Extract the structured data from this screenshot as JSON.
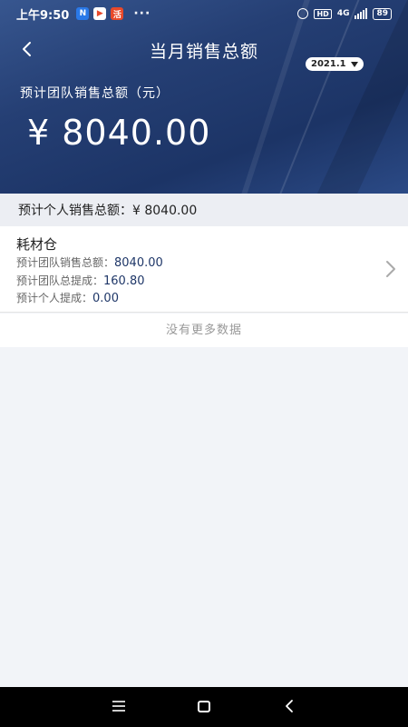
{
  "status_bar": {
    "time": "上午9:50",
    "dots": "···",
    "network": "4G",
    "hd": "HD",
    "battery": "89",
    "apps": [
      {
        "name": "n-app-icon",
        "glyph": "N",
        "color": "#2a79e8"
      },
      {
        "name": "video-app-icon",
        "glyph": "▶",
        "color": "#ffffff"
      },
      {
        "name": "red-app-icon",
        "glyph": "活",
        "color": "#e8492a"
      }
    ]
  },
  "header": {
    "title": "当月销售总额",
    "month": "2021.1",
    "team_label": "预计团队销售总额（元）",
    "team_amount": "¥ 8040.00"
  },
  "personal": {
    "text": "预计个人销售总额：¥ 8040.00"
  },
  "items": [
    {
      "name": "耗材仓",
      "team_sales_label": "预计团队销售总额：",
      "team_sales_value": "8040.00",
      "team_commission_label": "预计团队总提成：",
      "team_commission_value": "160.80",
      "personal_commission_label": "预计个人提成：",
      "personal_commission_value": "0.00"
    }
  ],
  "footer": {
    "no_more": "没有更多数据"
  },
  "colors": {
    "header_bg": "#253f74",
    "value_text": "#1f3768",
    "page_bg": "#f2f4f8"
  }
}
